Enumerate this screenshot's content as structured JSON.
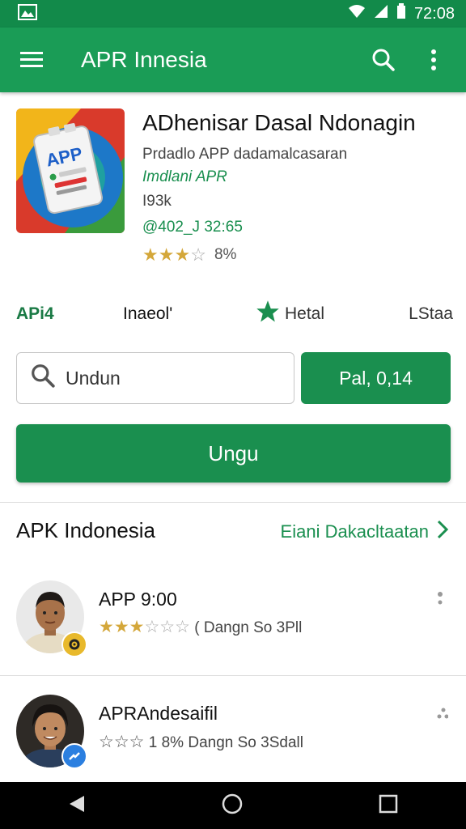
{
  "status_bar": {
    "time": "72:08"
  },
  "app_bar": {
    "title": "APR Innesia"
  },
  "app": {
    "icon_label": "APP",
    "name": "ADhenisar Dasal Ndonagin",
    "description": "Prdadlo APP dadamalcasaran",
    "developer": "Imdlani APR",
    "size": "I93k",
    "version": "@402_J 32:65",
    "rating_stars": 3.5,
    "rating_percent": "8%"
  },
  "stats": {
    "item1": "APi4",
    "item2": "Inaeol'",
    "item3": "Hetal",
    "item4": "LStaa"
  },
  "search": {
    "placeholder": "Undun"
  },
  "price_button": {
    "label": "Pal, 0,14"
  },
  "install_button": {
    "label": "Ungu"
  },
  "section": {
    "title": "APK Indonesia",
    "see_all": "Eiani Dakacltaatan"
  },
  "list": [
    {
      "title": "APP 9:00",
      "subtitle": "( Dangn So 3Pll",
      "stars": 3
    },
    {
      "title": "APRAndesaifil",
      "subtitle": "1 8% Dangn So 3Sdall",
      "stars": 3
    }
  ],
  "colors": {
    "primary": "#1a8f4f",
    "appbar": "#1a9c56",
    "accent_star": "#d4a73a"
  }
}
